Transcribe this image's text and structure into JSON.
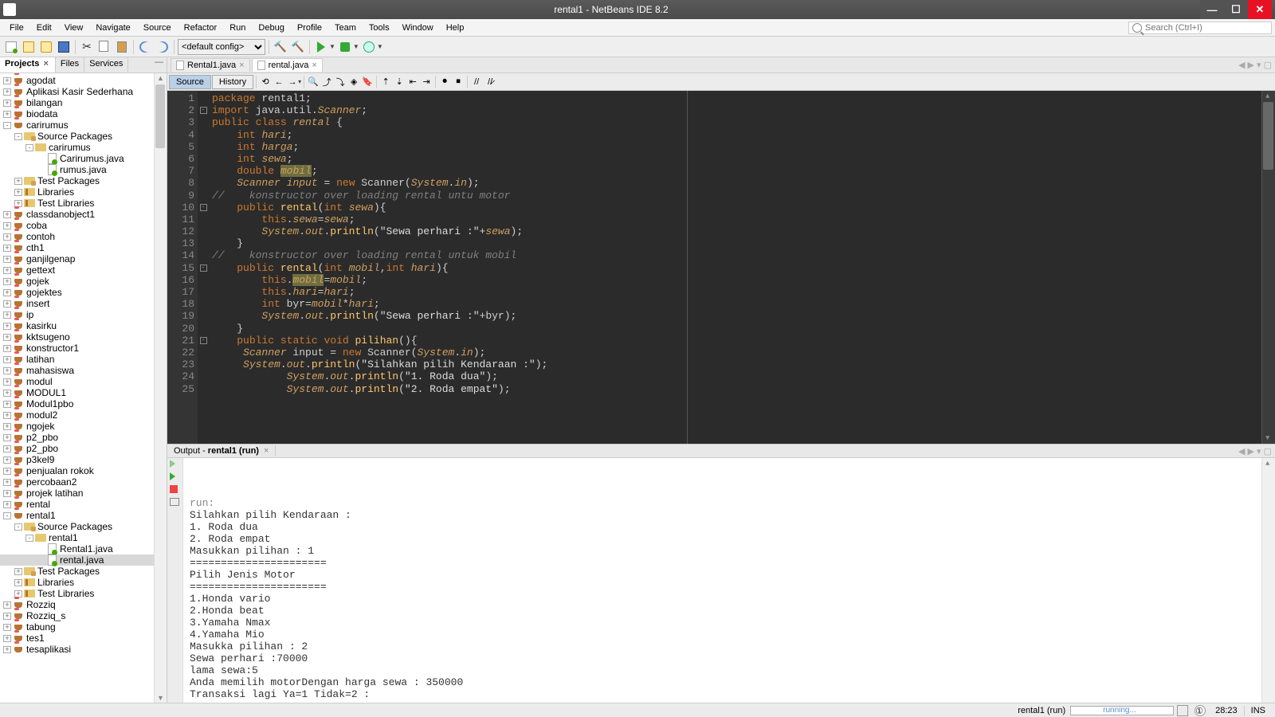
{
  "window": {
    "title": "rental1 - NetBeans IDE 8.2"
  },
  "menu": [
    "File",
    "Edit",
    "View",
    "Navigate",
    "Source",
    "Refactor",
    "Run",
    "Debug",
    "Profile",
    "Team",
    "Tools",
    "Window",
    "Help"
  ],
  "search": {
    "placeholder": "Search (Ctrl+I)"
  },
  "config_select": "<default config>",
  "panel_tabs": {
    "projects": "Projects",
    "files": "Files",
    "services": "Services"
  },
  "tree": [
    {
      "d": 0,
      "t": "+",
      "i": "proj",
      "l": "agodat"
    },
    {
      "d": 0,
      "t": "+",
      "i": "proj",
      "l": "Aplikasi Kasir Sederhana"
    },
    {
      "d": 0,
      "t": "+",
      "i": "proj",
      "l": "bilangan"
    },
    {
      "d": 0,
      "t": "+",
      "i": "proj",
      "l": "biodata"
    },
    {
      "d": 0,
      "t": "-",
      "i": "proj",
      "l": "carirumus"
    },
    {
      "d": 1,
      "t": "-",
      "i": "src",
      "l": "Source Packages"
    },
    {
      "d": 2,
      "t": "-",
      "i": "pkg",
      "l": "carirumus"
    },
    {
      "d": 3,
      "t": " ",
      "i": "java",
      "l": "Carirumus.java"
    },
    {
      "d": 3,
      "t": " ",
      "i": "java",
      "l": "rumus.java"
    },
    {
      "d": 1,
      "t": "+",
      "i": "src",
      "l": "Test Packages"
    },
    {
      "d": 1,
      "t": "+",
      "i": "lib",
      "l": "Libraries"
    },
    {
      "d": 1,
      "t": "+",
      "i": "lib",
      "l": "Test Libraries"
    },
    {
      "d": 0,
      "t": "+",
      "i": "proj",
      "l": "classdanobject1"
    },
    {
      "d": 0,
      "t": "+",
      "i": "proj",
      "l": "coba"
    },
    {
      "d": 0,
      "t": "+",
      "i": "proj",
      "l": "contoh"
    },
    {
      "d": 0,
      "t": "+",
      "i": "proj",
      "l": "cth1"
    },
    {
      "d": 0,
      "t": "+",
      "i": "proj",
      "l": "ganjilgenap"
    },
    {
      "d": 0,
      "t": "+",
      "i": "proj",
      "l": "gettext"
    },
    {
      "d": 0,
      "t": "+",
      "i": "proj",
      "l": "gojek"
    },
    {
      "d": 0,
      "t": "+",
      "i": "proj",
      "l": "gojektes"
    },
    {
      "d": 0,
      "t": "+",
      "i": "proj",
      "l": "insert"
    },
    {
      "d": 0,
      "t": "+",
      "i": "proj",
      "l": "ip"
    },
    {
      "d": 0,
      "t": "+",
      "i": "proj",
      "l": "kasirku"
    },
    {
      "d": 0,
      "t": "+",
      "i": "proj",
      "l": "kktsugeno"
    },
    {
      "d": 0,
      "t": "+",
      "i": "proj",
      "l": "konstructor1"
    },
    {
      "d": 0,
      "t": "+",
      "i": "proj",
      "l": "latihan"
    },
    {
      "d": 0,
      "t": "+",
      "i": "proj",
      "l": "mahasiswa"
    },
    {
      "d": 0,
      "t": "+",
      "i": "proj",
      "l": "modul"
    },
    {
      "d": 0,
      "t": "+",
      "i": "proj",
      "l": "MODUL1"
    },
    {
      "d": 0,
      "t": "+",
      "i": "proj",
      "l": "Modul1pbo"
    },
    {
      "d": 0,
      "t": "+",
      "i": "proj",
      "l": "modul2"
    },
    {
      "d": 0,
      "t": "+",
      "i": "proj",
      "l": "ngojek"
    },
    {
      "d": 0,
      "t": "+",
      "i": "proj",
      "l": "p2_pbo"
    },
    {
      "d": 0,
      "t": "+",
      "i": "proj",
      "l": "p2_pbo"
    },
    {
      "d": 0,
      "t": "+",
      "i": "proj",
      "l": "p3kel9"
    },
    {
      "d": 0,
      "t": "+",
      "i": "proj",
      "l": "penjualan rokok"
    },
    {
      "d": 0,
      "t": "+",
      "i": "proj",
      "l": "percobaan2"
    },
    {
      "d": 0,
      "t": "+",
      "i": "proj",
      "l": "projek latihan"
    },
    {
      "d": 0,
      "t": "+",
      "i": "proj",
      "l": "rental"
    },
    {
      "d": 0,
      "t": "-",
      "i": "proj",
      "l": "rental1"
    },
    {
      "d": 1,
      "t": "-",
      "i": "src",
      "l": "Source Packages"
    },
    {
      "d": 2,
      "t": "-",
      "i": "pkg",
      "l": "rental1"
    },
    {
      "d": 3,
      "t": " ",
      "i": "java",
      "l": "Rental1.java"
    },
    {
      "d": 3,
      "t": " ",
      "i": "java",
      "l": "rental.java",
      "sel": true
    },
    {
      "d": 1,
      "t": "+",
      "i": "src",
      "l": "Test Packages"
    },
    {
      "d": 1,
      "t": "+",
      "i": "lib",
      "l": "Libraries"
    },
    {
      "d": 1,
      "t": "+",
      "i": "lib",
      "l": "Test Libraries"
    },
    {
      "d": 0,
      "t": "+",
      "i": "proj",
      "l": "Rozziq"
    },
    {
      "d": 0,
      "t": "+",
      "i": "proj",
      "l": "Rozziq_s"
    },
    {
      "d": 0,
      "t": "+",
      "i": "proj",
      "l": "tabung"
    },
    {
      "d": 0,
      "t": "+",
      "i": "proj",
      "l": "tes1"
    },
    {
      "d": 0,
      "t": "+",
      "i": "proj",
      "l": "tesaplikasi"
    }
  ],
  "editor_tabs": [
    {
      "label": "Rental1.java"
    },
    {
      "label": "rental.java",
      "active": true
    }
  ],
  "et_buttons": {
    "source": "Source",
    "history": "History"
  },
  "code": {
    "lines": [
      {
        "n": 1,
        "f": "",
        "h": "<span class='kw1'>package</span> rental1<span class='op'>;</span>"
      },
      {
        "n": 2,
        "f": "-",
        "h": "<span class='kw1'>import</span> java.util.<span class='cls'>Scanner</span><span class='op'>;</span>"
      },
      {
        "n": 3,
        "f": "",
        "h": "<span class='kw1'>public</span> <span class='kw1'>class</span> <span class='cls'>rental</span> <span class='op'>{</span>"
      },
      {
        "n": 4,
        "f": "",
        "h": "    <span class='kw1'>int</span> <span class='var'>hari</span><span class='op'>;</span>"
      },
      {
        "n": 5,
        "f": "",
        "h": "    <span class='kw1'>int</span> <span class='var'>harga</span><span class='op'>;</span>"
      },
      {
        "n": 6,
        "f": "",
        "h": "    <span class='kw1'>int</span> <span class='var'>sewa</span><span class='op'>;</span>"
      },
      {
        "n": 7,
        "f": "",
        "h": "    <span class='kw1'>double</span> <span class='hl var'>mobil</span><span class='op'>;</span>"
      },
      {
        "n": 8,
        "f": "",
        "h": "    <span class='cls'>Scanner</span> <span class='var'>input</span> <span class='op'>=</span> <span class='kw1'>new</span> Scanner(<span class='cls'>System</span>.<span class='var'>in</span>)<span class='op'>;</span>"
      },
      {
        "n": 9,
        "f": "",
        "h": "<span class='com'>//    konstructor over loading rental untu motor</span>"
      },
      {
        "n": 10,
        "f": "-",
        "h": "    <span class='kw1'>public</span> <span class='mtd'>rental</span>(<span class='kw1'>int</span> <span class='var'>sewa</span>)<span class='op'>{</span>"
      },
      {
        "n": 11,
        "f": "",
        "h": "        <span class='kw1'>this</span>.<span class='var'>sewa</span>=<span class='var'>sewa</span><span class='op'>;</span>"
      },
      {
        "n": 12,
        "f": "",
        "h": "        <span class='cls'>System</span>.<span class='var'>out</span>.<span class='mtd'>println</span>(<span class='gstr'>\"Sewa perhari :\"</span>+<span class='var'>sewa</span>)<span class='op'>;</span>"
      },
      {
        "n": 13,
        "f": "",
        "h": "    <span class='op'>}</span>"
      },
      {
        "n": 14,
        "f": "",
        "h": "<span class='com'>//    konstructor over loading rental untuk mobil</span>"
      },
      {
        "n": 15,
        "f": "-",
        "h": "    <span class='kw1'>public</span> <span class='mtd'>rental</span>(<span class='kw1'>int</span> <span class='var'>mobil</span>,<span class='kw1'>int</span> <span class='var'>hari</span>)<span class='op'>{</span>"
      },
      {
        "n": 16,
        "f": "",
        "h": "        <span class='kw1'>this</span>.<span class='hl var'>mobil</span>=<span class='var'>mobil</span><span class='op'>;</span>"
      },
      {
        "n": 17,
        "f": "",
        "h": "        <span class='kw1'>this</span>.<span class='var'>hari</span>=<span class='var'>hari</span><span class='op'>;</span>"
      },
      {
        "n": 18,
        "f": "",
        "h": "        <span class='kw1'>int</span> byr=<span class='var'>mobil</span>*<span class='var'>hari</span><span class='op'>;</span>"
      },
      {
        "n": 19,
        "f": "",
        "h": "        <span class='cls'>System</span>.<span class='var'>out</span>.<span class='mtd'>println</span>(<span class='gstr'>\"Sewa perhari :\"</span>+byr)<span class='op'>;</span>"
      },
      {
        "n": 20,
        "f": "",
        "h": "    <span class='op'>}</span>"
      },
      {
        "n": 21,
        "f": "-",
        "h": "    <span class='kw1'>public</span> <span class='kw1'>static</span> <span class='kw1'>void</span> <span class='mtd'>pilihan</span>()<span class='op'>{</span>"
      },
      {
        "n": 22,
        "f": "",
        "h": "     <span class='cls'>Scanner</span> input <span class='op'>=</span> <span class='kw1'>new</span> Scanner(<span class='cls'>System</span>.<span class='var'>in</span>)<span class='op'>;</span>"
      },
      {
        "n": 23,
        "f": "",
        "h": "     <span class='cls'>System</span>.<span class='var'>out</span>.<span class='mtd'>println</span>(<span class='gstr'>\"Silahkan pilih Kendaraan :\"</span>)<span class='op'>;</span>"
      },
      {
        "n": 24,
        "f": "",
        "h": "            <span class='cls'>System</span>.<span class='var'>out</span>.<span class='mtd'>println</span>(<span class='gstr'>\"1. Roda dua\"</span>)<span class='op'>;</span>"
      },
      {
        "n": 25,
        "f": "",
        "h": "            <span class='cls'>System</span>.<span class='var'>out</span>.<span class='mtd'>println</span>(<span class='gstr'>\"2. Roda empat\"</span>)<span class='op'>;</span>"
      }
    ]
  },
  "output_tab": {
    "prefix": "Output - ",
    "name": "rental1 (run)"
  },
  "output": "run:\nSilahkan pilih Kendaraan :\n1. Roda dua\n2. Roda empat\nMasukkan pilihan : 1\n======================\nPilih Jenis Motor\n======================\n1.Honda vario\n2.Honda beat\n3.Yamaha Nmax\n4.Yamaha Mio\nMasukka pilihan : 2\nSewa perhari :70000\nlama sewa:5\nAnda memilih motorDengan harga sewa : 350000\nTransaksi lagi Ya=1 Tidak=2 : ",
  "status": {
    "task": "rental1 (run)",
    "running": "running...",
    "pos": "28:23",
    "ins": "INS"
  }
}
